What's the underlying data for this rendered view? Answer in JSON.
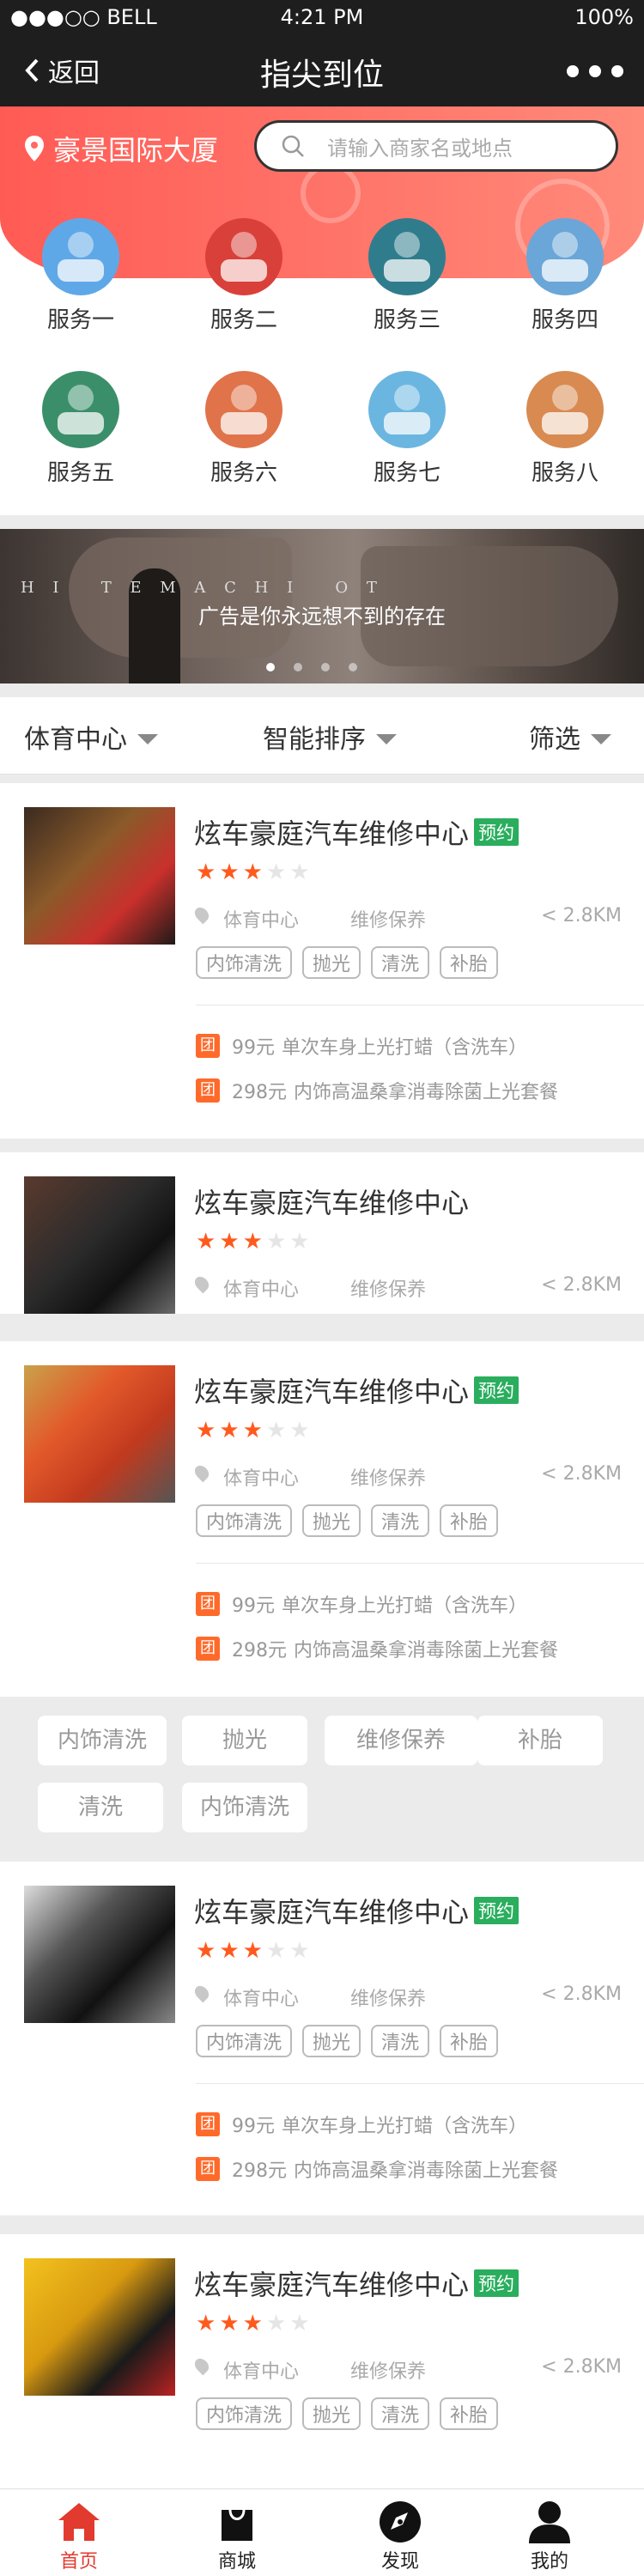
{
  "status_bar": {
    "carrier": "●●●○○ BELL",
    "time": "4:21 PM",
    "battery": "100%"
  },
  "nav": {
    "back_label": "返回",
    "title": "指尖到位"
  },
  "header": {
    "location": "豪景国际大厦",
    "search_placeholder": "请输入商家名或地点"
  },
  "services": [
    {
      "label": "服务一",
      "icon": "car-wash-icon",
      "color": "#5fa8e8"
    },
    {
      "label": "服务二",
      "icon": "car-driver-icon",
      "color": "#d9403a"
    },
    {
      "label": "服务三",
      "icon": "sofa-icon",
      "color": "#2f7d8c"
    },
    {
      "label": "服务四",
      "icon": "person-icon",
      "color": "#6aa6d8"
    },
    {
      "label": "服务五",
      "icon": "house-icon",
      "color": "#3a8f6a"
    },
    {
      "label": "服务六",
      "icon": "document-icon",
      "color": "#e0734a"
    },
    {
      "label": "服务七",
      "icon": "airplane-icon",
      "color": "#6bb6e0"
    },
    {
      "label": "服务八",
      "icon": "lock-icon",
      "color": "#d88a50"
    }
  ],
  "banner": {
    "strip_text": "H I   T E M A C H I   O T",
    "ad_text": "广告是你永远想不到的存在"
  },
  "filters": [
    "体育中心",
    "智能排序",
    "筛选"
  ],
  "cards": [
    {
      "title": "炫车豪庭汽车维修中心",
      "badge": "预约",
      "rating": 3,
      "area": "体育中心",
      "category": "维修保养",
      "distance": "< 2.8KM",
      "tags": [
        "内饰清洗",
        "抛光",
        "清洗",
        "补胎"
      ],
      "deals": [
        {
          "icon": "团",
          "price": "99元",
          "text": "单次车身上光打蜡（含洗车）"
        },
        {
          "icon": "团",
          "price": "298元",
          "text": "内饰高温桑拿消毒除菌上光套餐"
        }
      ]
    },
    {
      "title": "炫车豪庭汽车维修中心",
      "rating": 3,
      "area": "体育中心",
      "category": "维修保养",
      "distance": "< 2.8KM"
    },
    {
      "title": "炫车豪庭汽车维修中心",
      "badge": "预约",
      "rating": 3,
      "area": "体育中心",
      "category": "维修保养",
      "distance": "< 2.8KM",
      "tags": [
        "内饰清洗",
        "抛光",
        "清洗",
        "补胎"
      ],
      "deals": [
        {
          "icon": "团",
          "price": "99元",
          "text": "单次车身上光打蜡（含洗车）"
        },
        {
          "icon": "团",
          "price": "298元",
          "text": "内饰高温桑拿消毒除菌上光套餐"
        }
      ]
    },
    {
      "title": "炫车豪庭汽车维修中心",
      "badge": "预约",
      "rating": 3,
      "area": "体育中心",
      "category": "维修保养",
      "distance": "< 2.8KM",
      "tags": [
        "内饰清洗",
        "抛光",
        "清洗",
        "补胎"
      ],
      "deals": [
        {
          "icon": "团",
          "price": "99元",
          "text": "单次车身上光打蜡（含洗车）"
        },
        {
          "icon": "团",
          "price": "298元",
          "text": "内饰高温桑拿消毒除菌上光套餐"
        }
      ]
    },
    {
      "title": "炫车豪庭汽车维修中心",
      "badge": "预约",
      "rating": 3,
      "area": "体育中心",
      "category": "维修保养",
      "distance": "< 2.8KM",
      "tags": [
        "内饰清洗",
        "抛光",
        "清洗",
        "补胎"
      ]
    }
  ],
  "tag_cloud": [
    "内饰清洗",
    "抛光",
    "维修保养",
    "补胎",
    "清洗",
    "内饰清洗"
  ],
  "tabbar": [
    {
      "label": "首页",
      "icon": "home-icon",
      "active": true
    },
    {
      "label": "商城",
      "icon": "shopping-bag-icon",
      "active": false
    },
    {
      "label": "发现",
      "icon": "compass-icon",
      "active": false
    },
    {
      "label": "我的",
      "icon": "user-icon",
      "active": false
    }
  ],
  "colors": {
    "accent": "#ff5b55",
    "badge": "#2aae5e",
    "star": "#ff5a1e",
    "deal": "#ff6a2a",
    "tab_active": "#e23a2e"
  }
}
